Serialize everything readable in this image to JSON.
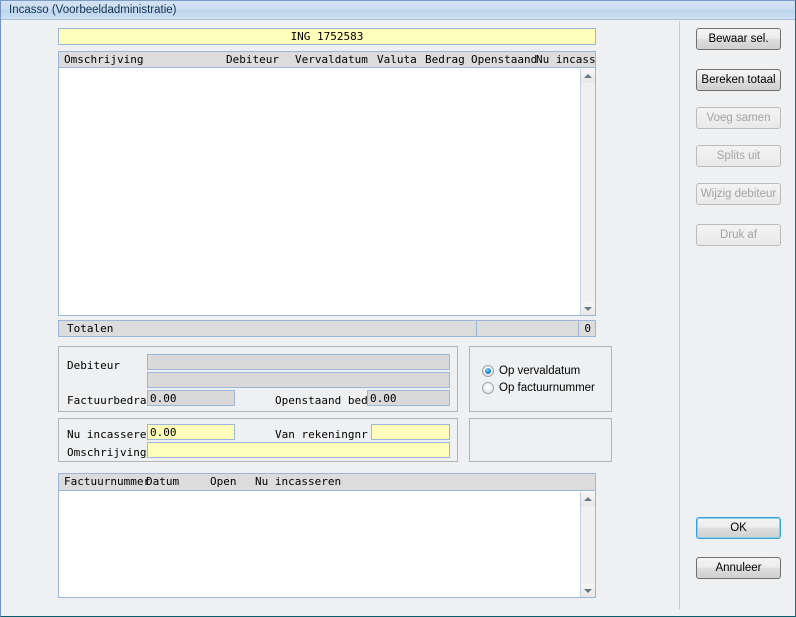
{
  "window": {
    "title": "Incasso (Voorbeeldadministratie)"
  },
  "account_field": {
    "value": "ING 1752583"
  },
  "main_grid": {
    "columns": [
      {
        "label": "Omschrijving"
      },
      {
        "label": "Debiteur"
      },
      {
        "label": "Vervaldatum"
      },
      {
        "label": "Valuta"
      },
      {
        "label": "Bedrag"
      },
      {
        "label": "Openstaand"
      },
      {
        "label": "Nu incasseren"
      }
    ],
    "rows": []
  },
  "totals": {
    "label": "Totalen",
    "amount": "",
    "count": "0"
  },
  "debtor_panel": {
    "debiteur_label": "Debiteur",
    "debiteur_name": "",
    "debiteur_address": "",
    "factuurbedrag_label": "Factuurbedrag",
    "factuurbedrag_value": "0.00",
    "openstaand_label": "Openstaand bedrag",
    "openstaand_value": "0.00"
  },
  "sort_panel": {
    "options": [
      {
        "label": "Op vervaldatum",
        "selected": true
      },
      {
        "label": "Op factuurnummer",
        "selected": false
      }
    ]
  },
  "collect_panel": {
    "nu_incasseren_label": "Nu incasseren",
    "nu_incasseren_value": "0.00",
    "van_rekeningnr_label": "Van rekeningnr",
    "van_rekeningnr_value": "",
    "omschrijving_label": "Omschrijving",
    "omschrijving_value": ""
  },
  "invoice_grid": {
    "columns": [
      {
        "label": "Factuurnummer"
      },
      {
        "label": "Datum"
      },
      {
        "label": "Open"
      },
      {
        "label": "Nu incasseren"
      }
    ],
    "rows": []
  },
  "buttons": {
    "bewaar_sel": "Bewaar sel.",
    "bereken_totaal": "Bereken totaal",
    "voeg_samen": "Voeg samen",
    "splits_uit": "Splits uit",
    "wijzig_debiteur": "Wijzig debiteur",
    "druk_af": "Druk af",
    "ok": "OK",
    "annuleer": "Annuleer"
  },
  "colors": {
    "editable_field": "#ffffbb",
    "readonly_field": "#d9d9d9",
    "dialog_background": "#eff0f1",
    "grid_header": "#dcdcdc",
    "field_border": "#9bb6d6",
    "window_border": "#0a5c6b",
    "radio_accent": "#1b8fd6"
  }
}
